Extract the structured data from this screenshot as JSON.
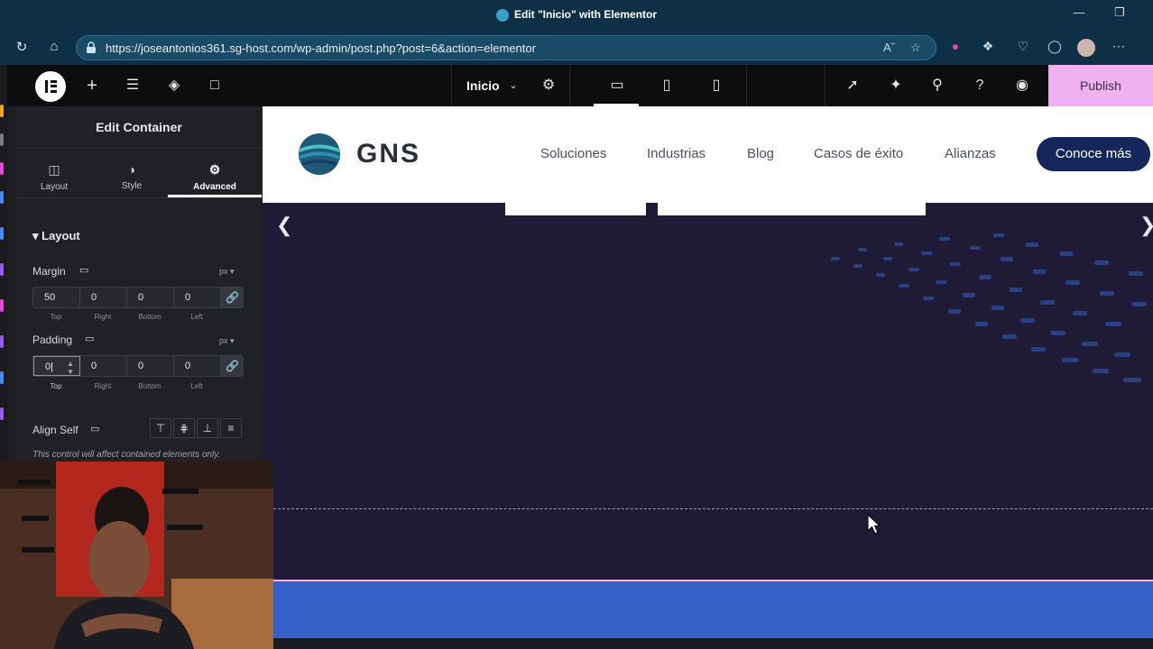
{
  "browser": {
    "window_title": "Edit \"Inicio\" with Elementor",
    "url": "https://joseantonios361.sg-host.com/wp-admin/post.php?post=6&action=elementor",
    "nav_icons": [
      "refresh-icon",
      "home-icon"
    ],
    "extension_icons": [
      "shield-extension-icon",
      "puzzle-icon",
      "heart-pulse-icon",
      "browser-shield-icon",
      "profile-avatar",
      "more-icon"
    ],
    "window_controls": [
      "minimize-icon",
      "restore-icon"
    ]
  },
  "elementor_topbar": {
    "page_selector": "Inicio",
    "device_modes": [
      "desktop-icon",
      "tablet-icon",
      "mobile-icon"
    ],
    "active_device": "desktop",
    "publish_label": "Publish",
    "accent_color": "#f0b1f0"
  },
  "panel": {
    "title": "Edit Container",
    "tabs": [
      {
        "label": "Layout",
        "icon": "layout-icon",
        "active": false
      },
      {
        "label": "Style",
        "icon": "style-icon",
        "active": false
      },
      {
        "label": "Advanced",
        "icon": "gear-icon",
        "active": true
      }
    ],
    "section_title": "Layout",
    "margin": {
      "label": "Margin",
      "unit": "px",
      "values": {
        "top": "50",
        "right": "0",
        "bottom": "0",
        "left": "0"
      },
      "sublabels": [
        "Top",
        "Right",
        "Bottom",
        "Left"
      ]
    },
    "padding": {
      "label": "Padding",
      "unit": "px",
      "values": {
        "top": "0",
        "right": "0",
        "bottom": "0",
        "left": "0"
      },
      "sublabels": [
        "Top",
        "Right",
        "Bottom",
        "Left"
      ]
    },
    "align_self": {
      "label": "Align Self",
      "note": "This control will affect contained elements only."
    }
  },
  "site": {
    "logo_text": "GNS",
    "nav": [
      "Soluciones",
      "Industrias",
      "Blog",
      "Casos de éxito",
      "Alianzas"
    ],
    "cta": "Conoce más",
    "brand_color": "#14265a",
    "hero_bg": "#1f1b36",
    "bottom_bar_color": "#3460c8"
  }
}
